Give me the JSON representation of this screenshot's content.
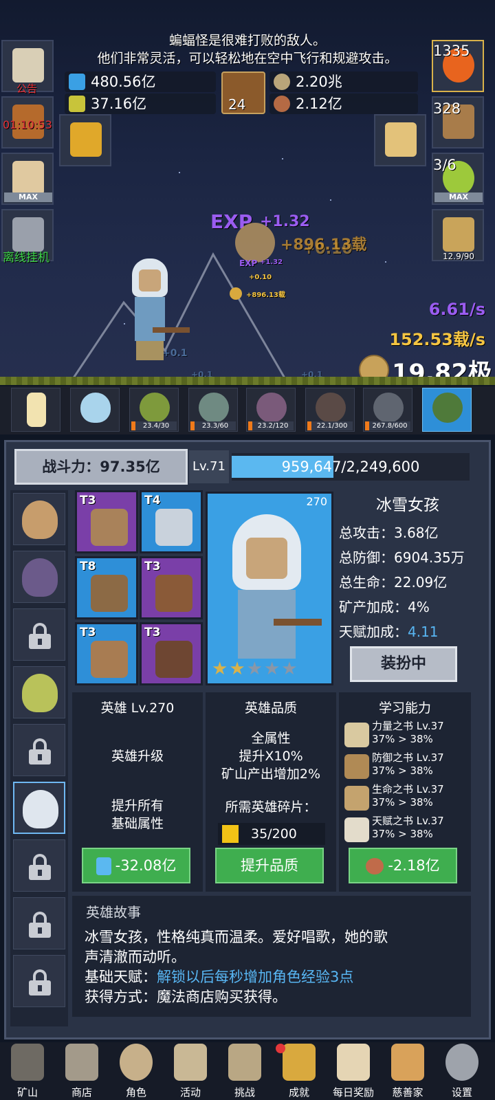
{
  "notice": {
    "line1": "蝙蝠怪是很难打败的敌人。",
    "line2": "他们非常灵活，可以轻松地在空中飞行和规避攻击。"
  },
  "resources": {
    "blue_potion": "480.56亿",
    "yellow_potion": "37.16亿",
    "book_count": "24",
    "coin": "2.20兆",
    "meat": "2.12亿"
  },
  "left_buttons": {
    "announcement": "公告",
    "timer": "01:10:53",
    "max": "MAX",
    "offline": "离线挂机"
  },
  "right_buttons": {
    "potion_count": "1335",
    "chest_count": "328",
    "slime_progress": "3/6",
    "max": "MAX",
    "sword_progress": "12.9/90"
  },
  "floats": {
    "exp_big": "EXP",
    "exp_big_val": "+1.32",
    "gold_big": "+896.13载",
    "gold_big_shadow": "+0.10",
    "exp_small": "EXP",
    "exp_small_val": "+1.32",
    "small_010": "+0.10",
    "small_gold": "+896.13载",
    "ground_01a": "+0.1",
    "ground_01b": "+0.1",
    "ground_01c": "+0.1"
  },
  "rates": {
    "exp_rate": "6.61/s",
    "gold_rate": "152.53载/s",
    "total_gold": "19.82极"
  },
  "monsters": [
    {
      "count": ""
    },
    {
      "count": ""
    },
    {
      "count": "23.4/30"
    },
    {
      "count": "23.3/60"
    },
    {
      "count": "23.2/120"
    },
    {
      "count": "22.1/300"
    },
    {
      "count": "267.8/600"
    },
    {
      "count": ""
    }
  ],
  "hero": {
    "power_label": "战斗力：97.35亿",
    "level": "Lv.71",
    "xp_text": "959,647/2,249,600",
    "xp_fraction": 0.4266,
    "name": "冰雪女孩",
    "card_level": "270",
    "stars": "★★★★★",
    "stats": {
      "attack": "总攻击：3.68亿",
      "defense": "总防御：6904.35万",
      "life": "总生命：22.09亿",
      "mine_label": "矿产加成：4%",
      "talent_label": "天赋加成：",
      "talent_value": "4.11"
    },
    "dress_button": "装扮中"
  },
  "equipment": [
    {
      "tier": "T3"
    },
    {
      "tier": "T4"
    },
    {
      "tier": "T8"
    },
    {
      "tier": "T3"
    },
    {
      "tier": "T3"
    },
    {
      "tier": "T3"
    }
  ],
  "upgrade": {
    "title": "英雄 Lv.270",
    "text1": "英雄升级",
    "text2a": "提升所有",
    "text2b": "基础属性",
    "button": "-32.08亿"
  },
  "quality": {
    "title": "英雄品质",
    "line1": "全属性",
    "line2": "提升X10%",
    "line3": "矿山产出增加2%",
    "shard_label": "所需英雄碎片：",
    "shard_count": "35/200",
    "button": "提升品质"
  },
  "learning": {
    "title": "学习能力",
    "books": [
      {
        "name": "力量之书 Lv.37",
        "progress": "37% > 38%"
      },
      {
        "name": "防御之书 Lv.37",
        "progress": "37% > 38%"
      },
      {
        "name": "生命之书 Lv.37",
        "progress": "37% > 38%"
      },
      {
        "name": "天赋之书 Lv.37",
        "progress": "37% > 38%"
      }
    ],
    "button": "-2.18亿"
  },
  "story": {
    "title": "英雄故事",
    "line1": "冰雪女孩，性格纯真而温柔。爱好唱歌，她的歌",
    "line2": "声清澈而动听。",
    "talent_label": "基础天赋：",
    "talent_text": "解锁以后每秒增加角色经验3点",
    "source": "获得方式：魔法商店购买获得。"
  },
  "nav": [
    {
      "label": "矿山"
    },
    {
      "label": "商店"
    },
    {
      "label": "角色"
    },
    {
      "label": "活动"
    },
    {
      "label": "挑战"
    },
    {
      "label": "成就"
    },
    {
      "label": "每日奖励"
    },
    {
      "label": "慈善家"
    },
    {
      "label": "设置"
    }
  ],
  "colors": {
    "exp_purple": "#9a5cf0",
    "gold_yellow": "#f5c542",
    "xp_fill": "#5bb8f0",
    "button_green": "#3fae4f",
    "talent_blue": "#58b6f3",
    "timer_red": "#e8323a",
    "offline_green": "#3ed34a"
  }
}
